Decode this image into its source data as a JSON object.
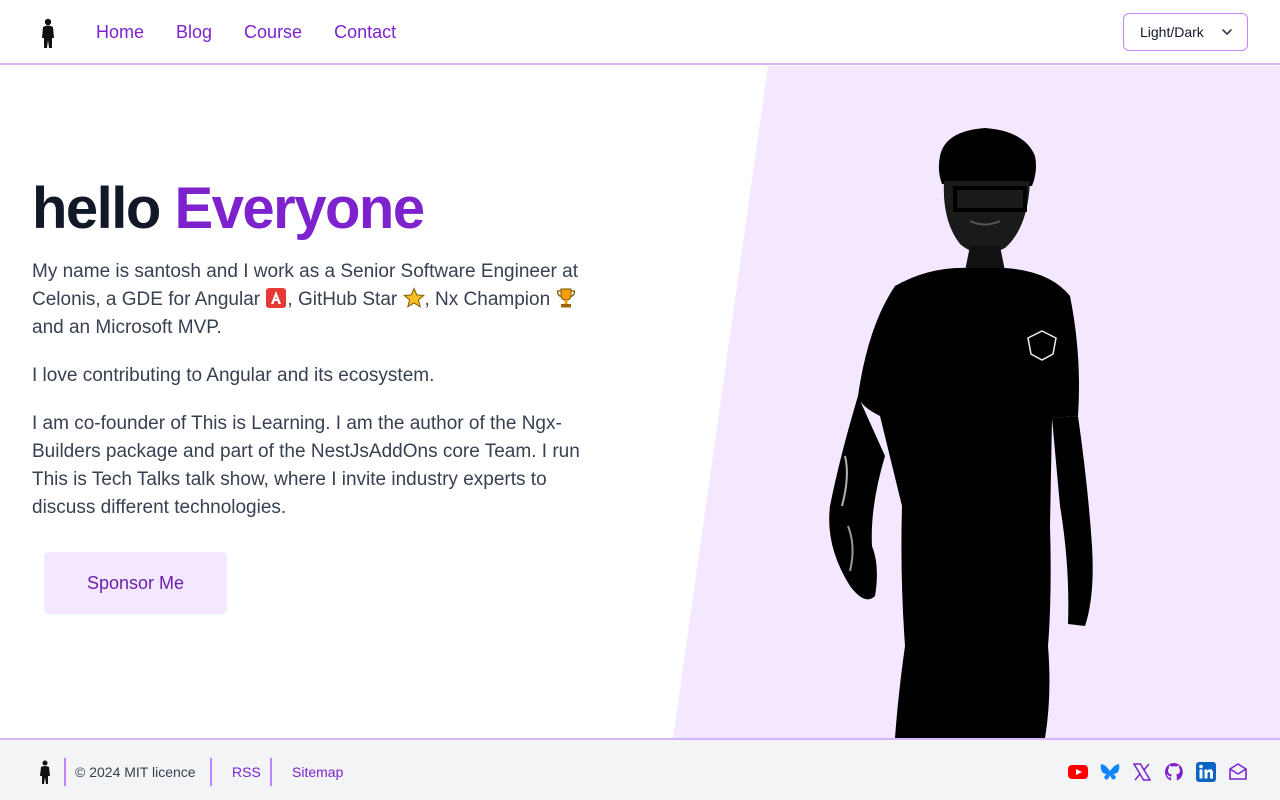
{
  "nav": {
    "items": [
      {
        "label": "Home"
      },
      {
        "label": "Blog"
      },
      {
        "label": "Course"
      },
      {
        "label": "Contact"
      }
    ]
  },
  "theme": {
    "label": "Light/Dark"
  },
  "hero": {
    "title_plain": "hello",
    "title_accent": "Everyone",
    "p1_a": "My name is santosh and I work as a Senior Software Engineer at Celonis, a GDE for Angular ",
    "p1_b": ", GitHub Star ",
    "p1_c": ", Nx Champion ",
    "p1_d": " and an Microsoft MVP.",
    "p2": "I love contributing to Angular and its ecosystem.",
    "p3": "I am co-founder of This is Learning. I am the author of the Ngx-Builders package and part of the NestJsAddOns core Team. I run This is Tech Talks talk show, where I invite industry experts to discuss different technologies.",
    "sponsor_label": "Sponsor Me"
  },
  "footer": {
    "copyright": "© 2024 MIT licence",
    "rss": "RSS",
    "sitemap": "Sitemap",
    "social_icons": [
      "youtube-icon",
      "bluesky-icon",
      "x-icon",
      "github-icon",
      "linkedin-icon",
      "mail-icon"
    ]
  },
  "colors": {
    "accent": "#7e22ce",
    "hero_panel": "#f3e8ff",
    "border": "#d8b4fe"
  }
}
